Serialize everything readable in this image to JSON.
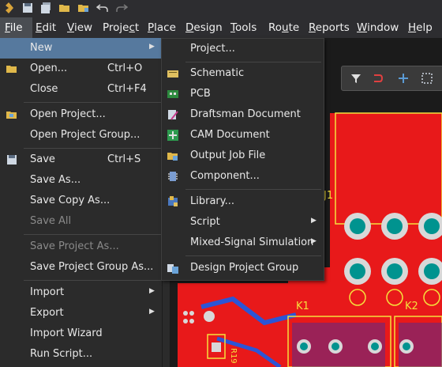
{
  "menubar": {
    "items": [
      "File",
      "Edit",
      "View",
      "Project",
      "Place",
      "Design",
      "Tools",
      "Route",
      "Reports",
      "Window",
      "Help"
    ],
    "underline": [
      "F",
      "E",
      "V",
      "c",
      "P",
      "D",
      "T",
      "u",
      "R",
      "W",
      "H"
    ]
  },
  "file_menu": {
    "new": "New",
    "open": "Open...",
    "open_shortcut": "Ctrl+O",
    "close": "Close",
    "close_shortcut": "Ctrl+F4",
    "open_project": "Open Project...",
    "open_project_group": "Open Project Group...",
    "save": "Save",
    "save_shortcut": "Ctrl+S",
    "save_as": "Save As...",
    "save_copy_as": "Save Copy As...",
    "save_all": "Save All",
    "save_project_as": "Save Project As...",
    "save_project_group_as": "Save Project Group As...",
    "import": "Import",
    "export": "Export",
    "import_wizard": "Import Wizard",
    "run_script": "Run Script..."
  },
  "new_submenu": {
    "project": "Project...",
    "schematic": "Schematic",
    "pcb": "PCB",
    "draftsman": "Draftsman Document",
    "cam": "CAM Document",
    "output_job": "Output Job File",
    "component": "Component...",
    "library": "Library...",
    "script": "Script",
    "mixed_signal": "Mixed-Signal Simulation",
    "design_project_group": "Design Project Group"
  },
  "pcb_canvas": {
    "labels": [
      "J1",
      "K1",
      "K2",
      "R19"
    ]
  },
  "colors": {
    "menu_bg": "#2b2b2b",
    "highlight": "#56799e",
    "pcb_red": "#e8191a",
    "pcb_pad": "#00938f",
    "pcb_yellow": "#f5e03c",
    "disabled_text": "#8a8a8a"
  }
}
